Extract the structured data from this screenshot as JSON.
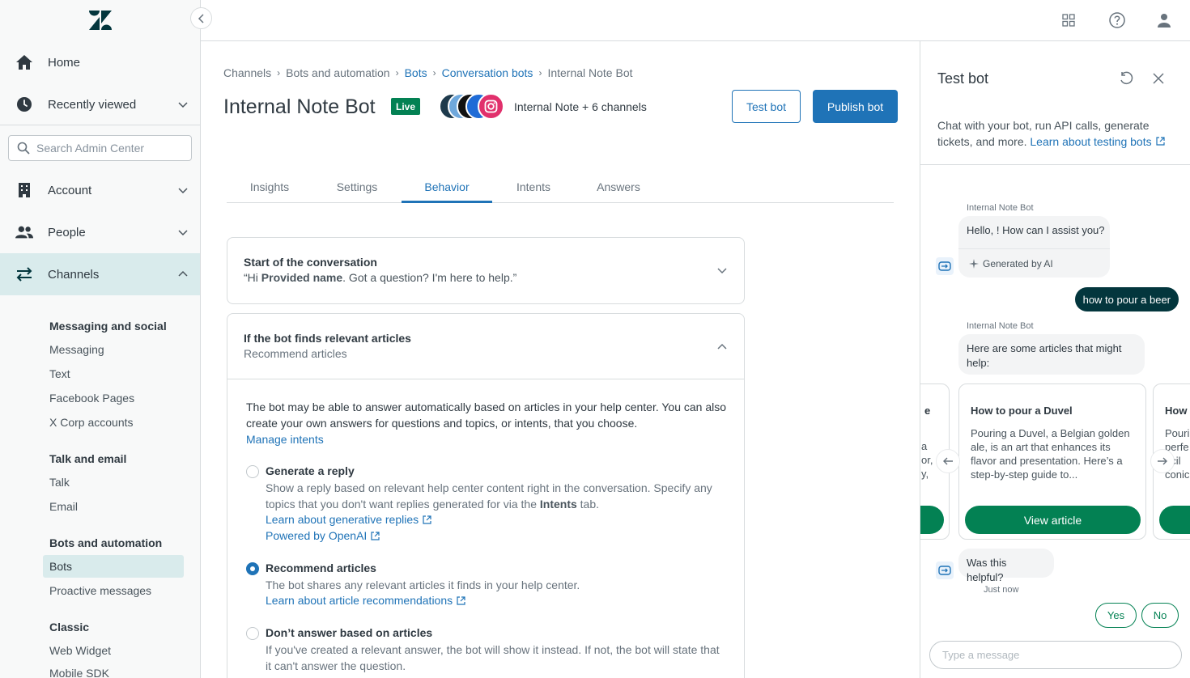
{
  "sidebar": {
    "search_placeholder": "Search Admin Center",
    "items": {
      "home": "Home",
      "recently_viewed": "Recently viewed",
      "account": "Account",
      "people": "People",
      "channels": "Channels"
    },
    "sections": [
      {
        "heading": "Messaging and social",
        "items": [
          "Messaging",
          "Text",
          "Facebook Pages",
          "X Corp accounts"
        ]
      },
      {
        "heading": "Talk and email",
        "items": [
          "Talk",
          "Email"
        ]
      },
      {
        "heading": "Bots and automation",
        "items": [
          "Bots",
          "Proactive messages"
        ]
      },
      {
        "heading": "Classic",
        "items": [
          "Web Widget",
          "Mobile SDK"
        ]
      }
    ],
    "active_item": "Bots"
  },
  "breadcrumb": [
    "Channels",
    "Bots and automation",
    "Bots",
    "Conversation bots",
    "Internal Note Bot"
  ],
  "page": {
    "title": "Internal Note Bot",
    "status_badge": "Live",
    "channels_summary": "Internal Note + 6 channels",
    "test_bot_button": "Test bot",
    "publish_button": "Publish bot"
  },
  "tabs": [
    "Insights",
    "Settings",
    "Behavior",
    "Intents",
    "Answers"
  ],
  "active_tab": "Behavior",
  "start_card": {
    "title": "Start of the conversation",
    "subtitle_prefix": "“Hi ",
    "subtitle_bold": "Provided name",
    "subtitle_suffix": ". Got a question? I'm here to help.”"
  },
  "articles_card": {
    "title": "If the bot finds relevant articles",
    "subtitle": "Recommend articles",
    "intro": "The bot may be able to answer automatically based on articles in your help center. You can also create your own answers for questions and topics, or intents, that you choose.",
    "manage_link": "Manage intents",
    "options": {
      "generate": {
        "label": "Generate a reply",
        "desc_prefix": "Show a reply based on relevant help center content right in the conversation. Specify any topics that you don't want replies generated for via the ",
        "desc_bold": "Intents",
        "desc_suffix": " tab.",
        "link1": "Learn about generative replies",
        "link2": "Powered by OpenAI"
      },
      "recommend": {
        "label": "Recommend articles",
        "desc": "The bot shares any relevant articles it finds in your help center.",
        "link": "Learn about article recommendations"
      },
      "dont": {
        "label": "Don’t answer based on articles",
        "desc": "If you've created a relevant answer, the bot will show it instead. If not, the bot will state that it can't answer the question."
      }
    },
    "selected_option": "recommend"
  },
  "test_panel": {
    "title": "Test bot",
    "desc": "Chat with your bot, run API calls, generate tickets, and more.",
    "desc_link": "Learn about testing bots",
    "bot_name": "Internal Note Bot",
    "greeting": "Hello, ! How can I assist you?",
    "generated_label": "Generated by AI",
    "user_message": "how to pour a beer",
    "articles_intro": "Here are some articles that might help:",
    "article": {
      "title": "How to pour a Duvel",
      "desc": "Pouring a Duvel, a Belgian golden ale, is an art that enhances its flavor and presentation. Here’s a step-by-step guide to...",
      "button": "View article"
    },
    "left_card_fragments": [
      "e",
      "a",
      "or,",
      "y,"
    ],
    "right_card_fragments": [
      "How t",
      "Pouri",
      "perfe",
      "ecil",
      "conic"
    ],
    "helpful_question": "Was this helpful?",
    "timestamp": "Just now",
    "yes": "Yes",
    "no": "No",
    "input_placeholder": "Type a message"
  },
  "colors": {
    "primary": "#1f73b7",
    "live": "#038153",
    "user_bubble": "#03363d",
    "active_nav": "#d9ebec"
  }
}
